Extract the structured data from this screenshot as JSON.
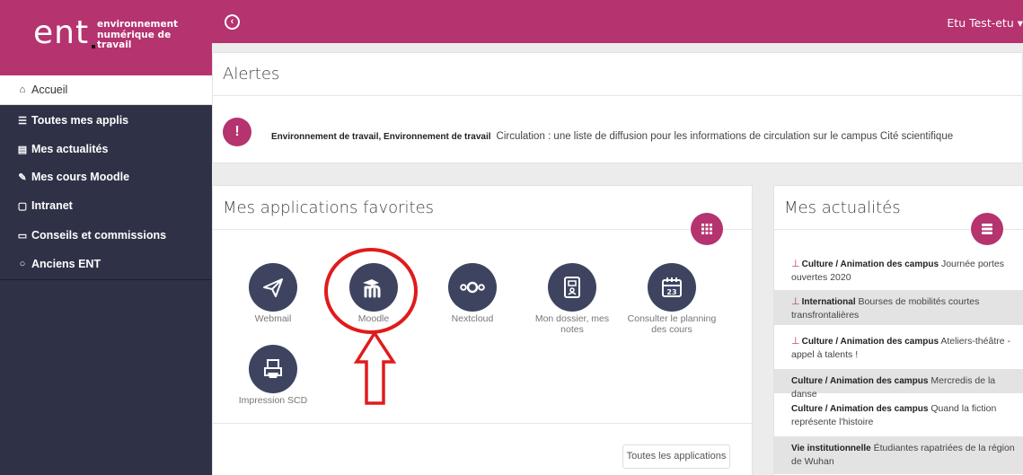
{
  "logo": {
    "text": "ent",
    "subtitle": "environnement numérique de travail"
  },
  "sidebar": {
    "items": [
      {
        "label": "Accueil",
        "icon": "home-icon",
        "glyph": "⌂"
      },
      {
        "label": "Toutes mes applis",
        "icon": "list-icon",
        "glyph": "☰"
      },
      {
        "label": "Mes actualités",
        "icon": "newspaper-icon",
        "glyph": "▤"
      },
      {
        "label": "Mes cours Moodle",
        "icon": "graduation-cap-icon",
        "glyph": "✎"
      },
      {
        "label": "Intranet",
        "icon": "file-icon",
        "glyph": "▢"
      },
      {
        "label": "Conseils et commissions",
        "icon": "folder-icon",
        "glyph": "▭"
      },
      {
        "label": "Anciens ENT",
        "icon": "circle-icon",
        "glyph": "○"
      }
    ]
  },
  "topbar": {
    "back_icon": "circle-arrow-left-icon",
    "user": "Etu Test-etu ▾"
  },
  "alerts": {
    "title": "Alertes",
    "item": {
      "source": "Environnement de travail, Environnement de travail",
      "text": "Circulation : une liste de diffusion pour les informations de circulation sur le campus Cité scientifique"
    }
  },
  "favorites": {
    "title": "Mes applications favorites",
    "apps": [
      {
        "label": "Webmail",
        "icon": "paper-plane-icon"
      },
      {
        "label": "Moodle",
        "icon": "moodle-icon"
      },
      {
        "label": "Nextcloud",
        "icon": "nextcloud-icon"
      },
      {
        "label": "Mon dossier, mes notes",
        "icon": "notebook-icon"
      },
      {
        "label": "Consulter le planning des cours",
        "icon": "calendar-icon"
      },
      {
        "label": "Impression SCD",
        "icon": "printer-icon"
      }
    ],
    "all_apps": "Toutes les applications"
  },
  "news": {
    "title": "Mes actualités",
    "items": [
      {
        "category": "Culture / Animation des campus",
        "text": "Journée portes ouvertes 2020",
        "pinned": true
      },
      {
        "category": "International",
        "text": "Bourses de mobilités courtes transfrontalières",
        "pinned": true
      },
      {
        "category": "Culture / Animation des campus",
        "text": "Ateliers-théâtre - appel à talents !",
        "pinned": true
      },
      {
        "category": "Culture / Animation des campus",
        "text": "Mercredis de la danse",
        "pinned": false
      },
      {
        "category": "Culture / Animation des campus",
        "text": "Quand la fiction représente l'histoire",
        "pinned": false
      },
      {
        "category": "Vie institutionnelle",
        "text": "Étudiantes rapatriées de la région de Wuhan",
        "pinned": false
      }
    ]
  },
  "colors": {
    "brand": "#b5336f",
    "sidebar": "#2f3247",
    "app_circle": "#3e4460",
    "annotation": "#e01b1b"
  }
}
